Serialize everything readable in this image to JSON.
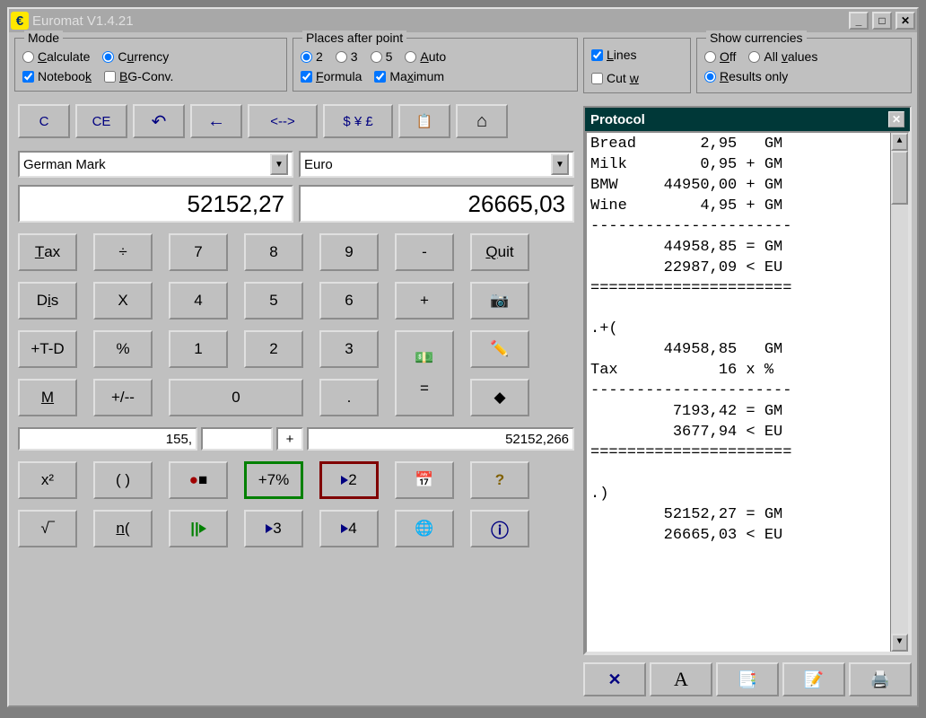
{
  "window": {
    "title": "Euromat V1.4.21"
  },
  "mode": {
    "title": "Mode",
    "calculate": "Calculate",
    "currency": "Currency",
    "notebook": "Notebook",
    "bgconv": "BG-Conv."
  },
  "places": {
    "title": "Places after point",
    "p2": "2",
    "p3": "3",
    "p5": "5",
    "auto": "Auto",
    "formula": "Formula",
    "maximum": "Maximum"
  },
  "rightOpts": {
    "lines": "Lines",
    "cutw": "Cut w"
  },
  "showCurr": {
    "title": "Show currencies",
    "off": "Off",
    "allvalues": "All values",
    "resultsonly": "Results only"
  },
  "toolbar": {
    "c": "C",
    "ce": "CE",
    "undo": "↶",
    "back": "←",
    "swap": "<-->",
    "curr": "$ ¥ £",
    "copy": "📋",
    "home": "⌂"
  },
  "currencies": {
    "from": "German Mark",
    "to": "Euro"
  },
  "display": {
    "left": "52152,27",
    "right": "26665,03"
  },
  "keys": {
    "tax": "Tax",
    "div": "÷",
    "k7": "7",
    "k8": "8",
    "k9": "9",
    "minus": "-",
    "quit": "Quit",
    "dis": "Dis",
    "mul": "X",
    "k4": "4",
    "k5": "5",
    "k6": "6",
    "plus": "+",
    "ptd": "+T-D",
    "pct": "%",
    "k1": "1",
    "k2": "2",
    "k3": "3",
    "m": "M",
    "pm": "+/--",
    "k0": "0",
    "dot": ".",
    "eq": "="
  },
  "status": {
    "f1": "155,",
    "f2": "",
    "f3": "+",
    "f4": "52152,266"
  },
  "bottom": {
    "sq": "x²",
    "paren": "( )",
    "rec": "●■",
    "p7": "+7%",
    "p2": "2",
    "sqrt": "√‾",
    "nparen": "n(",
    "pause": "||",
    "p3": "3",
    "p4": "4"
  },
  "protocol": {
    "title": "Protocol",
    "text": "Bread       2,95   GM\nMilk        0,95 + GM\nBMW     44950,00 + GM\nWine        4,95 + GM\n----------------------\n        44958,85 = GM\n        22987,09 < EU\n======================\n\n.+(\n        44958,85   GM\nTax           16 x %\n----------------------\n         7193,42 = GM\n         3677,94 < EU\n======================\n\n.)\n        52152,27 = GM\n        26665,03 < EU"
  }
}
